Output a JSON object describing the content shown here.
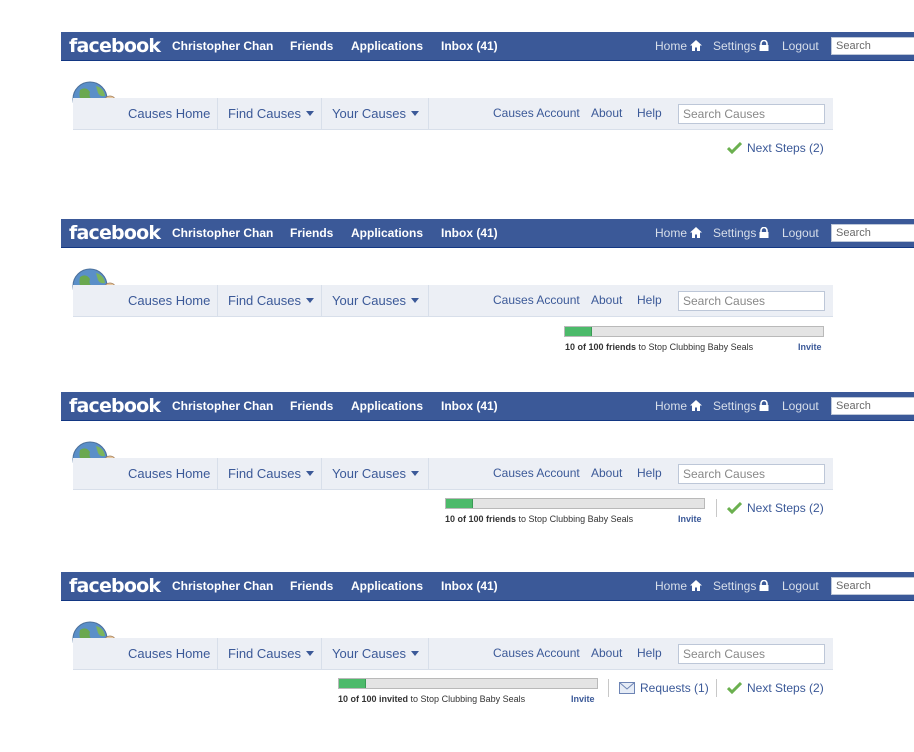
{
  "topbar": {
    "logo": "facebook",
    "user": "Christopher Chan",
    "friends": "Friends",
    "applications": "Applications",
    "inbox": "Inbox (41)",
    "home": "Home",
    "settings": "Settings",
    "logout": "Logout",
    "search_placeholder": "Search"
  },
  "causes_nav": {
    "home": "Causes Home",
    "find": "Find Causes",
    "yours": "Your Causes",
    "account": "Causes Account",
    "about": "About",
    "help": "Help",
    "search_placeholder": "Search Causes"
  },
  "actions": {
    "next_steps": "Next Steps (2)",
    "requests": "Requests (1)",
    "invite": "Invite",
    "cause": "to Stop Clubbing Baby Seals",
    "friends_progress": {
      "count": "10 of 100 friends",
      "value": 10,
      "max": 100
    },
    "invited_progress": {
      "count": "10 of 100 invited",
      "value": 10,
      "max": 100
    }
  },
  "colors": {
    "facebook_blue": "#3b5998",
    "nav_bg": "#eceff5",
    "progress_green": "#4cba6a"
  }
}
